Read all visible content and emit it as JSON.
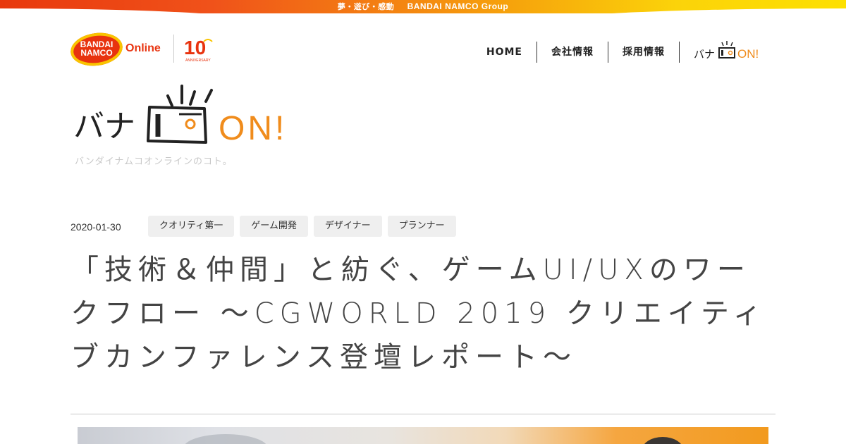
{
  "top_banner": {
    "tagline": "夢・遊び・感動",
    "brand": "BANDAI NAMCO Group"
  },
  "logo": {
    "brand_top": "BANDAI",
    "brand_bottom": "NAMCO",
    "online": "Online",
    "anniversary_number": "10",
    "anniversary_text": "ANNIVERSARY"
  },
  "nav": {
    "items": [
      {
        "label": "HOME"
      },
      {
        "label": "会社情報"
      },
      {
        "label": "採用情報"
      }
    ],
    "banaon_kana": "バナ",
    "banaon_on": "ON!"
  },
  "hero": {
    "kana": "バナ",
    "on": "ON!",
    "subtitle": "バンダイナムコオンラインのコト。"
  },
  "article": {
    "date": "2020-01-30",
    "tags": [
      "クオリティ第一",
      "ゲーム開発",
      "デザイナー",
      "プランナー"
    ],
    "title": "「技術＆仲間」と紡ぐ、ゲームUI/UXのワークフロー ～CGWORLD 2019 クリエイティブカンファレンス登壇レポート～"
  },
  "colors": {
    "brand_red": "#e8330f",
    "brand_yellow": "#f9c400",
    "accent_orange": "#f08c1c",
    "tag_bg": "#efefef"
  }
}
